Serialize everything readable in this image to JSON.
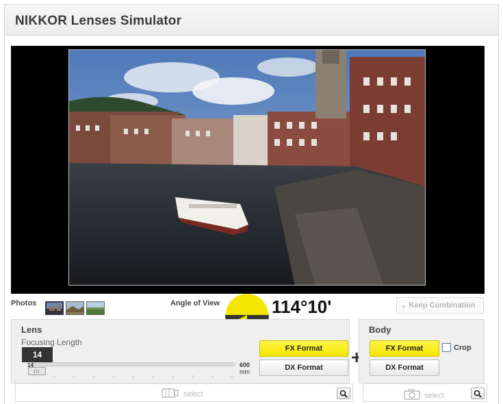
{
  "app": {
    "title": "NIKKOR Lenses Simulator"
  },
  "photos": {
    "label": "Photos",
    "thumbnails": [
      {
        "icon": "thumbnail-city-canal",
        "selected": true
      },
      {
        "icon": "thumbnail-landscape-1",
        "selected": false
      },
      {
        "icon": "thumbnail-landscape-2",
        "selected": false
      }
    ]
  },
  "angle_of_view": {
    "label": "Angle of View",
    "value": "114°10'"
  },
  "keep_combination": {
    "label": "Keep Combination",
    "icon": "chevron-down-icon"
  },
  "lens": {
    "title": "Lens",
    "focusing_length_label": "Focusing Length",
    "focal_value": "14",
    "slider_min": "14",
    "slider_max": "600",
    "slider_unit": "mm",
    "fx_label": "FX Format",
    "dx_label": "DX Format",
    "select_label": "select",
    "select_icon": "lens-icon"
  },
  "plus_sign": "+",
  "body": {
    "title": "Body",
    "fx_label": "FX Format",
    "dx_label": "DX Format",
    "crop_label": "Crop",
    "crop_checked": false,
    "select_label": "select",
    "select_icon": "camera-icon"
  },
  "colors": {
    "accent_yellow": "#f5e600",
    "gauge_dark": "#333333"
  }
}
